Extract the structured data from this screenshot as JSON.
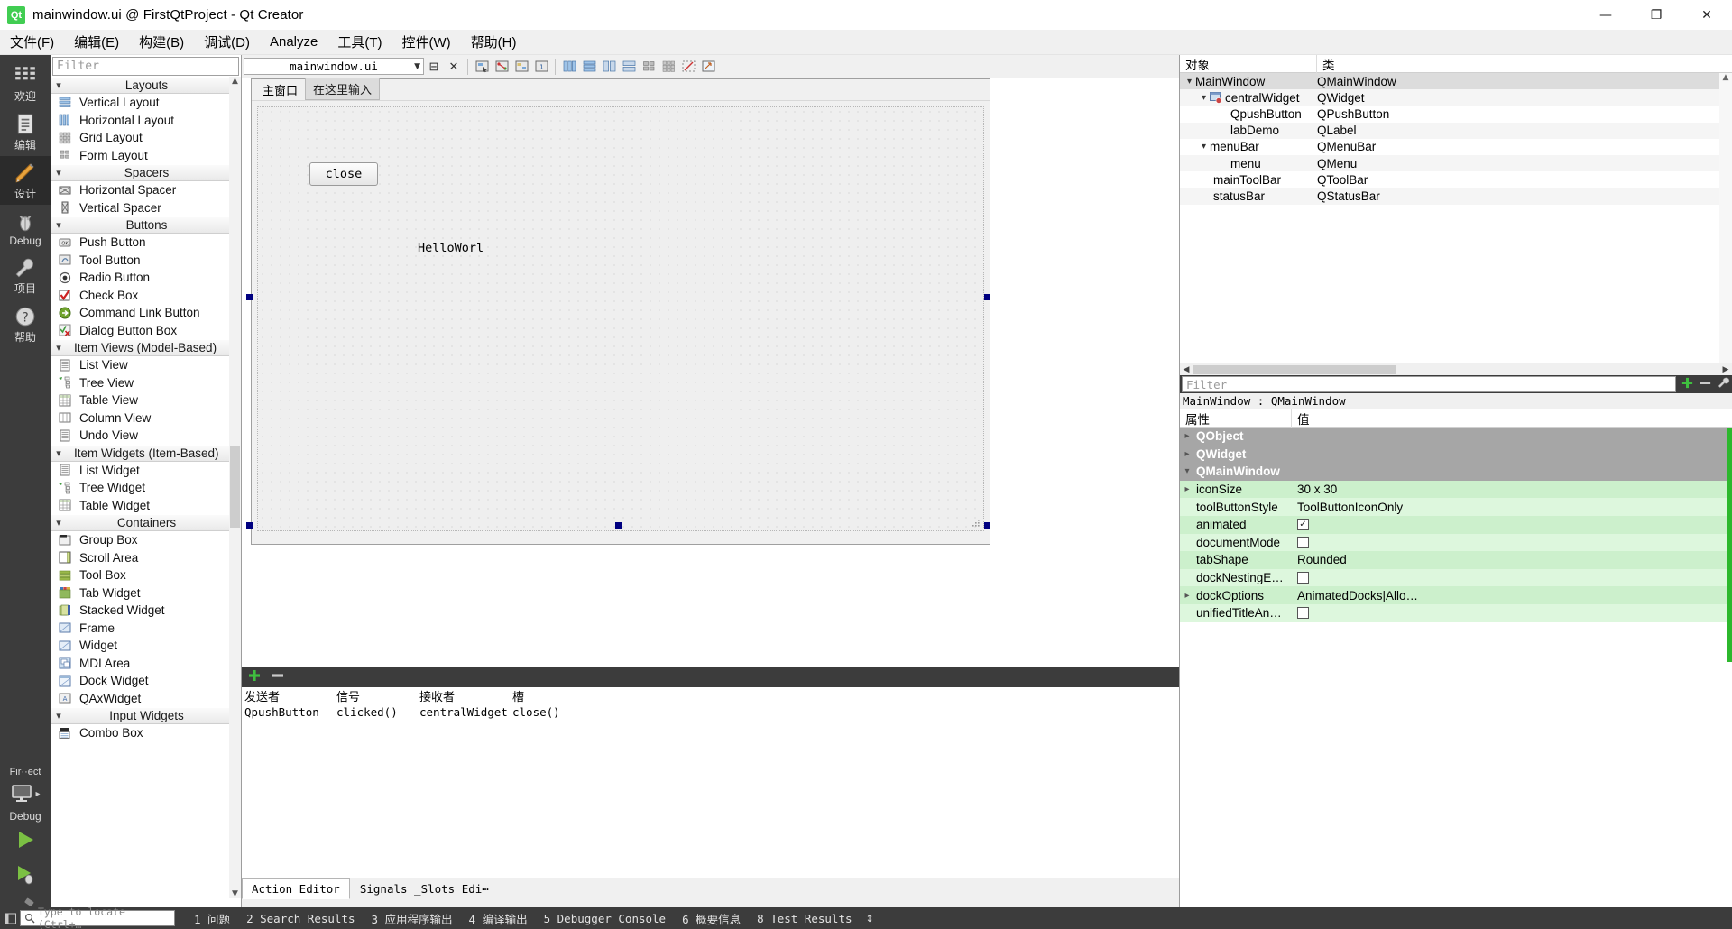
{
  "window": {
    "title": "mainwindow.ui @ FirstQtProject - Qt Creator",
    "app_icon": "qt-logo-icon",
    "minimize": "—",
    "maximize": "❐",
    "close": "✕"
  },
  "menubar": {
    "items": [
      {
        "label": "文件(F)",
        "mnemonic": "F"
      },
      {
        "label": "编辑(E)",
        "mnemonic": "E"
      },
      {
        "label": "构建(B)",
        "mnemonic": "B"
      },
      {
        "label": "调试(D)",
        "mnemonic": "D"
      },
      {
        "label": "Analyze",
        "mnemonic": "A"
      },
      {
        "label": "工具(T)",
        "mnemonic": "T"
      },
      {
        "label": "控件(W)",
        "mnemonic": "W"
      },
      {
        "label": "帮助(H)",
        "mnemonic": "H"
      }
    ]
  },
  "modebar": {
    "items": [
      {
        "label": "欢迎",
        "icon": "welcome-grid-icon",
        "active": false
      },
      {
        "label": "编辑",
        "icon": "edit-document-icon",
        "active": false
      },
      {
        "label": "设计",
        "icon": "design-pencil-icon",
        "active": true
      },
      {
        "label": "Debug",
        "icon": "debug-bug-icon",
        "active": false
      },
      {
        "label": "项目",
        "icon": "projects-wrench-icon",
        "active": false
      },
      {
        "label": "帮助",
        "icon": "help-question-icon",
        "active": false
      }
    ],
    "kit": {
      "project_name": "Fir··ect",
      "build_config": "Debug",
      "icon": "monitor-icon",
      "run_label": "run-green-triangle",
      "debug_label": "debug-run-icon",
      "build_label": "build-hammer-icon"
    }
  },
  "widgetbox": {
    "filter_placeholder": "Filter",
    "groups": [
      {
        "title": "Layouts",
        "expanded": true,
        "items": [
          {
            "label": "Vertical Layout",
            "icon": "vertical-layout-icon"
          },
          {
            "label": "Horizontal Layout",
            "icon": "horizontal-layout-icon"
          },
          {
            "label": "Grid Layout",
            "icon": "grid-layout-icon"
          },
          {
            "label": "Form Layout",
            "icon": "form-layout-icon"
          }
        ]
      },
      {
        "title": "Spacers",
        "expanded": true,
        "items": [
          {
            "label": "Horizontal Spacer",
            "icon": "horizontal-spacer-icon"
          },
          {
            "label": "Vertical Spacer",
            "icon": "vertical-spacer-icon"
          }
        ]
      },
      {
        "title": "Buttons",
        "expanded": true,
        "items": [
          {
            "label": "Push Button",
            "icon": "push-button-icon"
          },
          {
            "label": "Tool Button",
            "icon": "tool-button-icon"
          },
          {
            "label": "Radio Button",
            "icon": "radio-button-icon"
          },
          {
            "label": "Check Box",
            "icon": "check-box-icon"
          },
          {
            "label": "Command Link Button",
            "icon": "command-link-button-icon"
          },
          {
            "label": "Dialog Button Box",
            "icon": "dialog-button-box-icon"
          }
        ]
      },
      {
        "title": "Item Views (Model-Based)",
        "expanded": true,
        "items": [
          {
            "label": "List View",
            "icon": "list-view-icon"
          },
          {
            "label": "Tree View",
            "icon": "tree-view-icon"
          },
          {
            "label": "Table View",
            "icon": "table-view-icon"
          },
          {
            "label": "Column View",
            "icon": "column-view-icon"
          },
          {
            "label": "Undo View",
            "icon": "undo-view-icon"
          }
        ]
      },
      {
        "title": "Item Widgets (Item-Based)",
        "expanded": true,
        "items": [
          {
            "label": "List Widget",
            "icon": "list-widget-icon"
          },
          {
            "label": "Tree Widget",
            "icon": "tree-widget-icon"
          },
          {
            "label": "Table Widget",
            "icon": "table-widget-icon"
          }
        ]
      },
      {
        "title": "Containers",
        "expanded": true,
        "items": [
          {
            "label": "Group Box",
            "icon": "group-box-icon"
          },
          {
            "label": "Scroll Area",
            "icon": "scroll-area-icon"
          },
          {
            "label": "Tool Box",
            "icon": "tool-box-icon"
          },
          {
            "label": "Tab Widget",
            "icon": "tab-widget-icon"
          },
          {
            "label": "Stacked Widget",
            "icon": "stacked-widget-icon"
          },
          {
            "label": "Frame",
            "icon": "frame-icon"
          },
          {
            "label": "Widget",
            "icon": "widget-icon"
          },
          {
            "label": "MDI Area",
            "icon": "mdi-area-icon"
          },
          {
            "label": "Dock Widget",
            "icon": "dock-widget-icon"
          },
          {
            "label": "QAxWidget",
            "icon": "qaxwidget-icon"
          }
        ]
      },
      {
        "title": "Input Widgets",
        "expanded": true,
        "items": [
          {
            "label": "Combo Box",
            "icon": "combo-box-icon"
          }
        ]
      }
    ]
  },
  "editor_toolbar": {
    "file_combo_value": "mainwindow.ui",
    "split_label": "⊟",
    "close_label": "✕",
    "tools": [
      {
        "name": "edit-widgets-icon",
        "glyph": "▣"
      },
      {
        "name": "edit-signals-slots-icon",
        "glyph": "⎇"
      },
      {
        "name": "edit-buddies-icon",
        "glyph": "◧"
      },
      {
        "name": "edit-tab-order-icon",
        "glyph": "≣"
      },
      {
        "name": "layout-horizontally-icon",
        "glyph": "‖"
      },
      {
        "name": "layout-vertically-icon",
        "glyph": "≡"
      },
      {
        "name": "layout-in-splitter-h-icon",
        "glyph": "▥"
      },
      {
        "name": "layout-in-splitter-v-icon",
        "glyph": "▤"
      },
      {
        "name": "layout-in-form-icon",
        "glyph": "☷"
      },
      {
        "name": "layout-in-grid-icon",
        "glyph": "⊞"
      },
      {
        "name": "break-layout-icon",
        "glyph": "⬚"
      },
      {
        "name": "adjust-size-icon",
        "glyph": "⇲"
      }
    ]
  },
  "form": {
    "menubar_items": [
      {
        "label": "主窗口",
        "placeholder": false
      },
      {
        "label": "在这里输入",
        "placeholder": true
      }
    ],
    "push_button_text": "close",
    "label_text": "HelloWorl",
    "size_grip": "resize-grip-icon"
  },
  "signals_slots_editor": {
    "add_label": "+",
    "remove_label": "−",
    "columns": [
      "发送者",
      "信号",
      "接收者",
      "槽"
    ],
    "rows": [
      {
        "sender": "QpushButton",
        "signal": "clicked()",
        "receiver": "centralWidget",
        "slot": "close()"
      }
    ]
  },
  "designer_tabs": {
    "tabs": [
      {
        "label": "Action Editor",
        "active": true
      },
      {
        "label": "Signals _Slots Edi⋯",
        "active": false
      }
    ]
  },
  "object_inspector": {
    "columns": [
      "对象",
      "类"
    ],
    "rows": [
      {
        "name": "MainWindow",
        "class": "QMainWindow",
        "indent": 0,
        "chevron": "down",
        "selected": true,
        "icon": ""
      },
      {
        "name": "centralWidget",
        "class": "QWidget",
        "indent": 1,
        "chevron": "down",
        "selected": false,
        "icon": "central-widget-icon"
      },
      {
        "name": "QpushButton",
        "class": "QPushButton",
        "indent": 3,
        "chevron": "",
        "selected": false,
        "icon": ""
      },
      {
        "name": "labDemo",
        "class": "QLabel",
        "indent": 3,
        "chevron": "",
        "selected": false,
        "icon": ""
      },
      {
        "name": "menuBar",
        "class": "QMenuBar",
        "indent": 1,
        "chevron": "down",
        "selected": false,
        "icon": ""
      },
      {
        "name": "menu",
        "class": "QMenu",
        "indent": 3,
        "chevron": "",
        "selected": false,
        "icon": ""
      },
      {
        "name": "mainToolBar",
        "class": "QToolBar",
        "indent": 2,
        "chevron": "",
        "selected": false,
        "icon": ""
      },
      {
        "name": "statusBar",
        "class": "QStatusBar",
        "indent": 2,
        "chevron": "",
        "selected": false,
        "icon": ""
      }
    ]
  },
  "property_editor": {
    "filter_placeholder": "Filter",
    "add_icon": "plus-icon",
    "remove_icon": "minus-icon",
    "config_icon": "wrench-icon",
    "object_line": "MainWindow : QMainWindow",
    "columns": [
      "属性",
      "值"
    ],
    "rows": [
      {
        "key": "QObject",
        "value": "",
        "type": "group",
        "chevron": "right"
      },
      {
        "key": "QWidget",
        "value": "",
        "type": "group",
        "chevron": "right"
      },
      {
        "key": "QMainWindow",
        "value": "",
        "type": "group",
        "chevron": "down"
      },
      {
        "key": "iconSize",
        "value": "30 x 30",
        "type": "prop",
        "chevron": "right"
      },
      {
        "key": "toolButtonStyle",
        "value": "ToolButtonIconOnly",
        "type": "prop",
        "chevron": ""
      },
      {
        "key": "animated",
        "value": "",
        "type": "check",
        "checked": true,
        "chevron": ""
      },
      {
        "key": "documentMode",
        "value": "",
        "type": "check",
        "checked": false,
        "chevron": ""
      },
      {
        "key": "tabShape",
        "value": "Rounded",
        "type": "prop",
        "chevron": ""
      },
      {
        "key": "dockNestingE…",
        "value": "",
        "type": "check",
        "checked": false,
        "chevron": ""
      },
      {
        "key": "dockOptions",
        "value": "AnimatedDocks|Allo…",
        "type": "prop",
        "chevron": "right"
      },
      {
        "key": "unifiedTitleAn…",
        "value": "",
        "type": "check",
        "checked": false,
        "chevron": ""
      }
    ]
  },
  "statusbar": {
    "sidebar_toggle_icon": "sidebar-toggle-icon",
    "locator_placeholder": "Type to locate (Ctrl+…",
    "search_icon": "search-icon",
    "items": [
      "1 问题",
      "2 Search Results",
      "3 应用程序输出",
      "4 编译输出",
      "5 Debugger Console",
      "6 概要信息",
      "8 Test Results"
    ],
    "updown_icon": "↕"
  },
  "colors": {
    "mode_bar_bg": "#3c3c3c",
    "accent_green": "#41cd52",
    "property_group_bg": "#a6a6a6",
    "property_row_bg": "#ccf0cc",
    "selection_handle": "#000080"
  }
}
